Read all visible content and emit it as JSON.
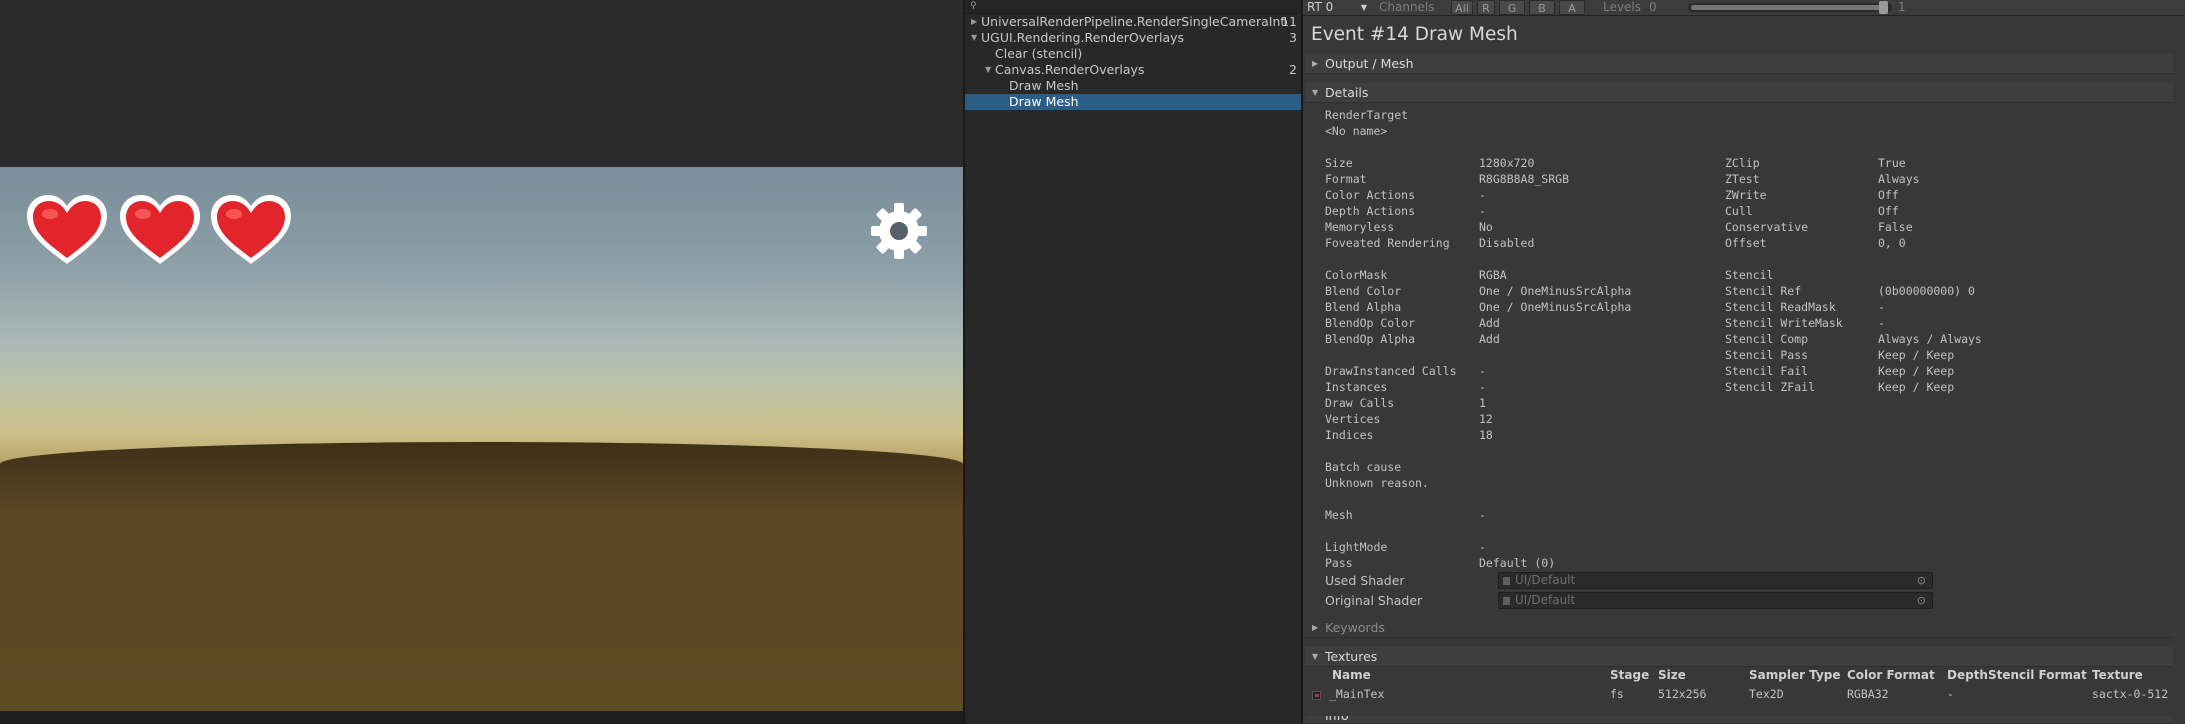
{
  "tree": {
    "rows": [
      {
        "label": "UniversalRenderPipeline.RenderSingleCameraInternal",
        "count": "11"
      },
      {
        "label": "UGUI.Rendering.RenderOverlays",
        "count": "3"
      },
      {
        "label": "Clear (stencil)",
        "count": ""
      },
      {
        "label": "Canvas.RenderOverlays",
        "count": "2"
      },
      {
        "label": "Draw Mesh",
        "count": ""
      },
      {
        "label": "Draw Mesh",
        "count": ""
      }
    ]
  },
  "toolbar": {
    "rt": "RT 0",
    "channels_label": "Channels",
    "channels": [
      "All",
      "R",
      "G",
      "B",
      "A"
    ],
    "levels_label": "Levels",
    "levels_min": "0",
    "levels_max": "1"
  },
  "event_title": "Event #14 Draw Mesh",
  "sections": {
    "output_mesh": "Output / Mesh",
    "details": "Details",
    "keywords": "Keywords",
    "textures": "Textures",
    "info": "Info"
  },
  "details": {
    "render_target_label": "RenderTarget",
    "render_target_value": "<No name>",
    "left": [
      {
        "k": "Size",
        "v": "1280x720"
      },
      {
        "k": "Format",
        "v": "R8G8B8A8_SRGB"
      },
      {
        "k": "Color Actions",
        "v": "-"
      },
      {
        "k": "Depth Actions",
        "v": "-"
      },
      {
        "k": "Memoryless",
        "v": "No"
      },
      {
        "k": "Foveated Rendering",
        "v": "Disabled"
      }
    ],
    "right": [
      {
        "k": "ZClip",
        "v": "True"
      },
      {
        "k": "ZTest",
        "v": "Always"
      },
      {
        "k": "ZWrite",
        "v": "Off"
      },
      {
        "k": "Cull",
        "v": "Off"
      },
      {
        "k": "Conservative",
        "v": "False"
      },
      {
        "k": "Offset",
        "v": "0, 0"
      }
    ],
    "blend": [
      {
        "k": "ColorMask",
        "v": "RGBA"
      },
      {
        "k": "Blend Color",
        "v": "One / OneMinusSrcAlpha"
      },
      {
        "k": "Blend Alpha",
        "v": "One / OneMinusSrcAlpha"
      },
      {
        "k": "BlendOp Color",
        "v": "Add"
      },
      {
        "k": "BlendOp Alpha",
        "v": "Add"
      }
    ],
    "stencil": [
      {
        "k": "Stencil",
        "v": ""
      },
      {
        "k": "Stencil Ref",
        "v": "(0b00000000) 0"
      },
      {
        "k": "Stencil ReadMask",
        "v": "-"
      },
      {
        "k": "Stencil WriteMask",
        "v": "-"
      },
      {
        "k": "Stencil Comp",
        "v": "Always / Always"
      },
      {
        "k": "Stencil Pass",
        "v": "Keep / Keep"
      },
      {
        "k": "Stencil Fail",
        "v": "Keep / Keep"
      },
      {
        "k": "Stencil ZFail",
        "v": "Keep / Keep"
      }
    ],
    "calls": [
      {
        "k": "DrawInstanced Calls",
        "v": "-"
      },
      {
        "k": "Instances",
        "v": "-"
      },
      {
        "k": "Draw Calls",
        "v": "1"
      },
      {
        "k": "Vertices",
        "v": "12"
      },
      {
        "k": "Indices",
        "v": "18"
      }
    ],
    "batch_cause_label": "Batch cause",
    "batch_cause_value": "Unknown reason.",
    "mesh_label": "Mesh",
    "mesh_value": "-",
    "lightmode_label": "LightMode",
    "lightmode_value": "-",
    "pass_label": "Pass",
    "pass_value": "Default (0)",
    "used_shader_label": "Used Shader",
    "used_shader_value": "UI/Default",
    "original_shader_label": "Original Shader",
    "original_shader_value": "UI/Default"
  },
  "textures": {
    "headers": [
      "Name",
      "Stage",
      "Size",
      "Sampler Type",
      "Color Format",
      "DepthStencil Format",
      "Texture"
    ],
    "row": [
      "_MainTex",
      "fs",
      "512x256",
      "Tex2D",
      "RGBA32",
      "-",
      "sactx-0-512"
    ]
  },
  "colors": {
    "selection": "#2c5d87",
    "heart": "#e2252b",
    "panel": "#383838"
  }
}
